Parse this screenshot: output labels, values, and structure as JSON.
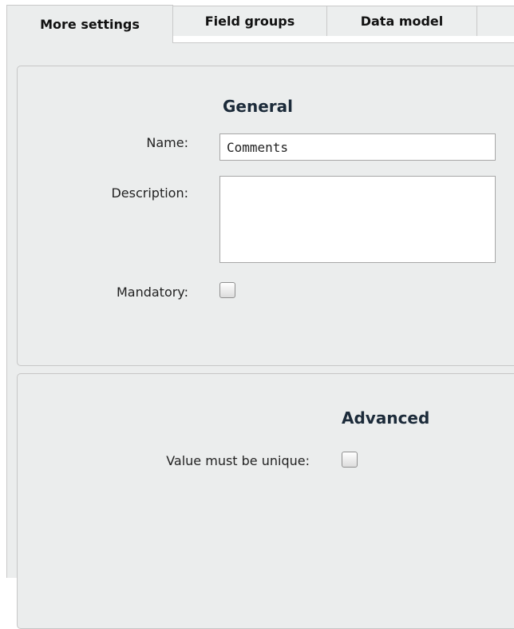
{
  "tabs": [
    {
      "label": "More settings",
      "active": true
    },
    {
      "label": "Field groups",
      "active": false
    },
    {
      "label": "Data model",
      "active": false
    }
  ],
  "general": {
    "heading": "General",
    "name_label": "Name:",
    "name_value": "Comments",
    "description_label": "Description:",
    "description_value": "",
    "mandatory_label": "Mandatory:",
    "mandatory_checked": false
  },
  "advanced": {
    "heading": "Advanced",
    "unique_label": "Value must be unique:",
    "unique_checked": false
  },
  "colors": {
    "panel_background": "#ebeded",
    "border": "#c9c9c9",
    "heading_text": "#1c2b3a"
  }
}
